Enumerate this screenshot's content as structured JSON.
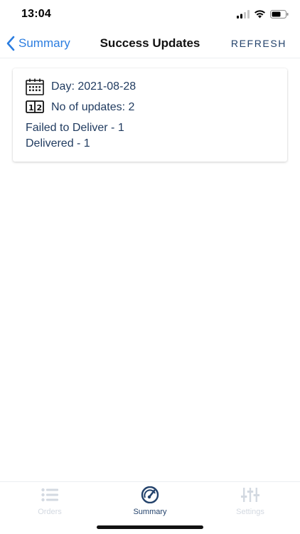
{
  "status_bar": {
    "time": "13:04"
  },
  "nav": {
    "back_label": "Summary",
    "title": "Success Updates",
    "refresh_label": "REFRESH"
  },
  "card": {
    "day": "Day: 2021-08-28",
    "updates": "No of updates: 2",
    "lines": [
      "Failed to Deliver - 1",
      "Delivered - 1"
    ]
  },
  "tabs": [
    {
      "label": "Orders",
      "icon": "list-icon",
      "active": false
    },
    {
      "label": "Summary",
      "icon": "gauge-icon",
      "active": true
    },
    {
      "label": "Settings",
      "icon": "sliders-icon",
      "active": false
    }
  ],
  "colors": {
    "accent": "#2b7de0",
    "navy": "#23426b",
    "inactive": "#d3d9e1"
  }
}
